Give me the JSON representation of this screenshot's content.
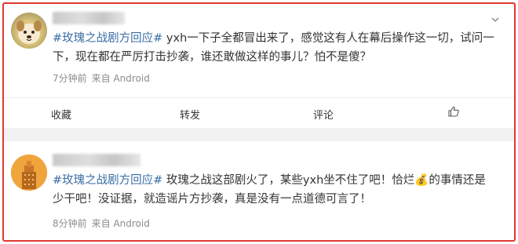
{
  "posts": [
    {
      "tag": "#玫瑰之战剧方回应#",
      "text": "yxh一下子全都冒出来了，感觉这有人在幕后操作这一切，试问一下，现在都在严厉打击抄袭，谁还敢做这样的事儿？怕不是傻？",
      "time": "7分钟前",
      "source": "来自 Android"
    },
    {
      "tag": "#玫瑰之战剧方回应#",
      "text": "玫瑰之战这部剧火了，某些yxh坐不住了吧！恰烂💰的事情还是少干吧！没证据，就造谣片方抄袭，真是没有一点道德可言了！",
      "time": "8分钟前",
      "source": "来自 Android"
    }
  ],
  "actions": {
    "favorite": "收藏",
    "repost": "转发",
    "comment": "评论"
  },
  "colors": {
    "frame": "#e03a2f",
    "tag": "#3a6ea5"
  },
  "icons": {
    "more": "chevron-down-icon",
    "like": "thumbs-up-icon"
  }
}
